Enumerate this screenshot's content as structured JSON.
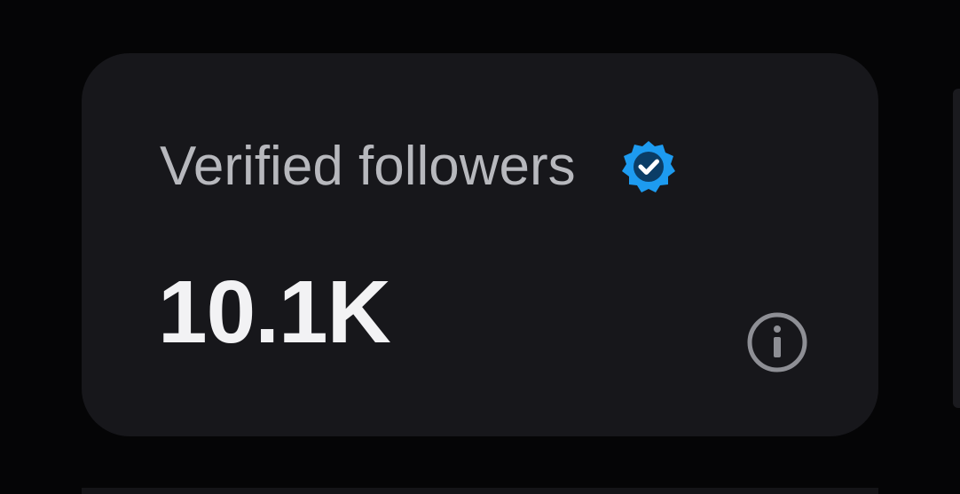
{
  "card": {
    "title": "Verified followers",
    "count": "10.1K",
    "badge_icon": "verified-badge-icon",
    "info_icon": "info-icon"
  },
  "colors": {
    "background": "#050506",
    "card": "#17171b",
    "title": "#b7b8bd",
    "count": "#f2f2f4",
    "badge": "#1d9bf0",
    "info": "#8e8f95"
  }
}
